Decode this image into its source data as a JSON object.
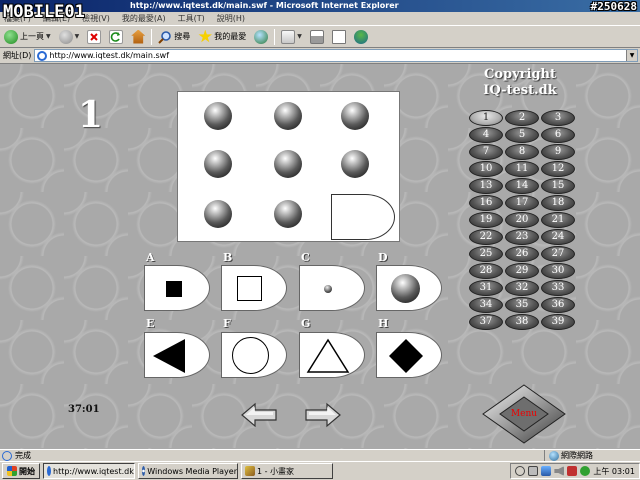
{
  "watermark": {
    "brand": "MOBILE01",
    "post_id": "#250628"
  },
  "window": {
    "title": "http://www.iqtest.dk/main.swf - Microsoft Internet Explorer"
  },
  "menubar": {
    "items": [
      "檔案(F)",
      "編輯(E)",
      "檢視(V)",
      "我的最愛(A)",
      "工具(T)",
      "說明(H)"
    ]
  },
  "toolbar": {
    "back_label": "上一頁",
    "search_label": "搜尋",
    "favorites_label": "我的最愛"
  },
  "address": {
    "label": "網址(D)",
    "url": "http://www.iqtest.dk/main.swf"
  },
  "test": {
    "question_number": "1",
    "copyright_line1": "Copyright",
    "copyright_line2": "IQ-test.dk",
    "timer": "37:01",
    "menu_label": "Menu",
    "current_question": 1,
    "questions": [
      "1",
      "2",
      "3",
      "4",
      "5",
      "6",
      "7",
      "8",
      "9",
      "10",
      "11",
      "12",
      "13",
      "14",
      "15",
      "16",
      "17",
      "18",
      "19",
      "20",
      "21",
      "22",
      "23",
      "24",
      "25",
      "26",
      "27",
      "28",
      "29",
      "30",
      "31",
      "32",
      "33",
      "34",
      "35",
      "36",
      "37",
      "38",
      "39"
    ],
    "options": [
      {
        "label": "A",
        "shape": "small-filled-square"
      },
      {
        "label": "B",
        "shape": "outlined-square"
      },
      {
        "label": "C",
        "shape": "small-dot"
      },
      {
        "label": "D",
        "shape": "shaded-sphere"
      },
      {
        "label": "E",
        "shape": "filled-left-triangle"
      },
      {
        "label": "F",
        "shape": "outlined-circle"
      },
      {
        "label": "G",
        "shape": "outlined-triangle"
      },
      {
        "label": "H",
        "shape": "filled-diamond"
      }
    ]
  },
  "statusbar": {
    "text": "完成",
    "zone": "網際網路"
  },
  "taskbar": {
    "start_label": "開始",
    "tasks": [
      "http://www.iqtest.dk/main...",
      "Windows Media Player",
      "1 - 小畫家"
    ],
    "clock": "上午 03:01"
  }
}
